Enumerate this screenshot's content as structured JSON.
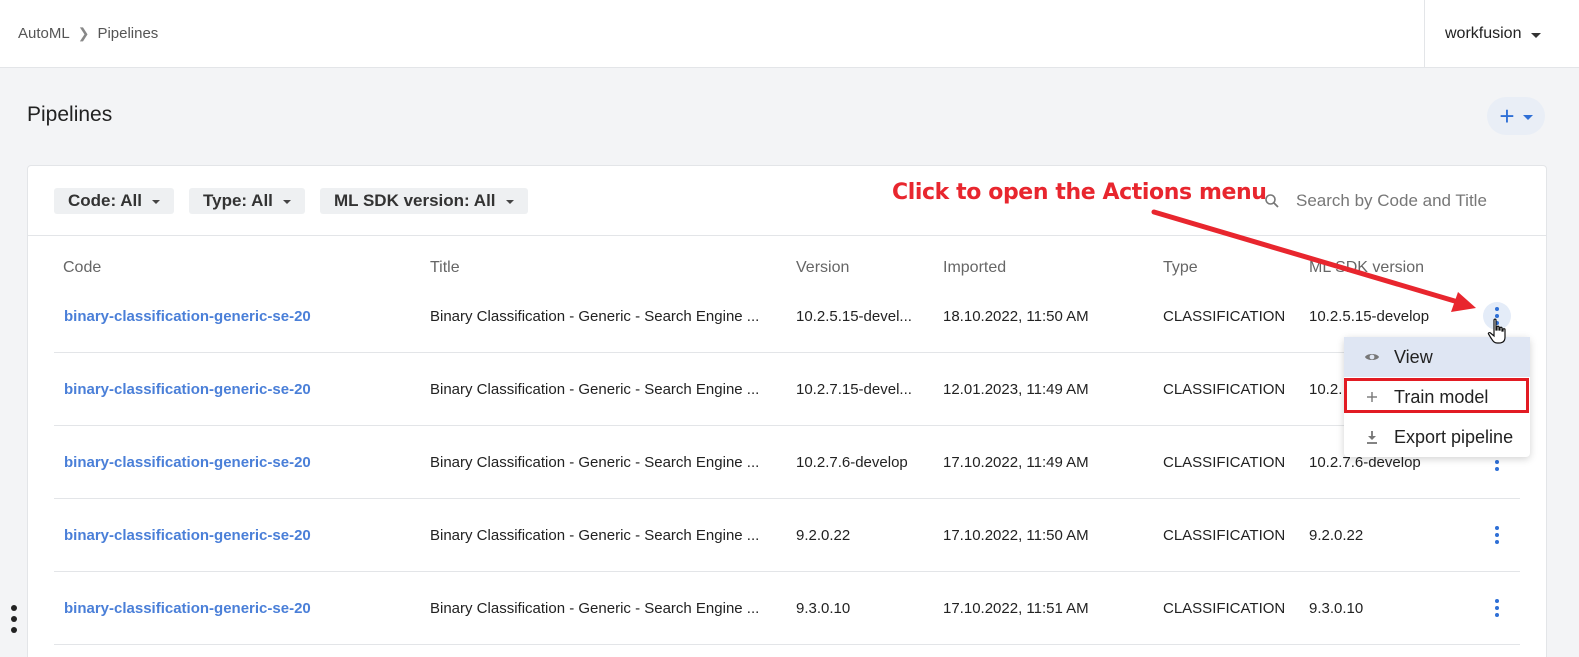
{
  "breadcrumb": {
    "root": "AutoML",
    "current": "Pipelines"
  },
  "workspace": {
    "name": "workfusion"
  },
  "page": {
    "title": "Pipelines"
  },
  "filters": {
    "code": "Code: All",
    "type": "Type: All",
    "ml_sdk": "ML SDK version: All"
  },
  "search": {
    "placeholder": "Search by Code and Title"
  },
  "annotation": {
    "callout": "Click to open the Actions menu",
    "color": "#e8262e"
  },
  "table": {
    "headers": [
      "Code",
      "Title",
      "Version",
      "Imported",
      "Type",
      "ML SDK version"
    ],
    "rows": [
      [
        "binary-classification-generic-se-20",
        "Binary Classification - Generic - Search Engine ...",
        "10.2.5.15-devel...",
        "18.10.2022, 11:50 AM",
        "CLASSIFICATION",
        "10.2.5.15-develop"
      ],
      [
        "binary-classification-generic-se-20",
        "Binary Classification - Generic - Search Engine ...",
        "10.2.7.15-devel...",
        "12.01.2023, 11:49 AM",
        "CLASSIFICATION",
        "10.2."
      ],
      [
        "binary-classification-generic-se-20",
        "Binary Classification - Generic - Search Engine ...",
        "10.2.7.6-develop",
        "17.10.2022, 11:49 AM",
        "CLASSIFICATION",
        "10.2.7.6-develop"
      ],
      [
        "binary-classification-generic-se-20",
        "Binary Classification - Generic - Search Engine ...",
        "9.2.0.22",
        "17.10.2022, 11:50 AM",
        "CLASSIFICATION",
        "9.2.0.22"
      ],
      [
        "binary-classification-generic-se-20",
        "Binary Classification - Generic - Search Engine ...",
        "9.3.0.10",
        "17.10.2022, 11:51 AM",
        "CLASSIFICATION",
        "9.3.0.10"
      ]
    ]
  },
  "actions_menu": {
    "items": [
      {
        "label": "View",
        "icon": "eye-icon"
      },
      {
        "label": "Train model",
        "icon": "plus-icon"
      },
      {
        "label": "Export pipeline",
        "icon": "download-icon"
      }
    ]
  },
  "colors": {
    "accent": "#2e6fd6",
    "link": "#4a7fd8",
    "highlight_box": "#e21b23"
  }
}
